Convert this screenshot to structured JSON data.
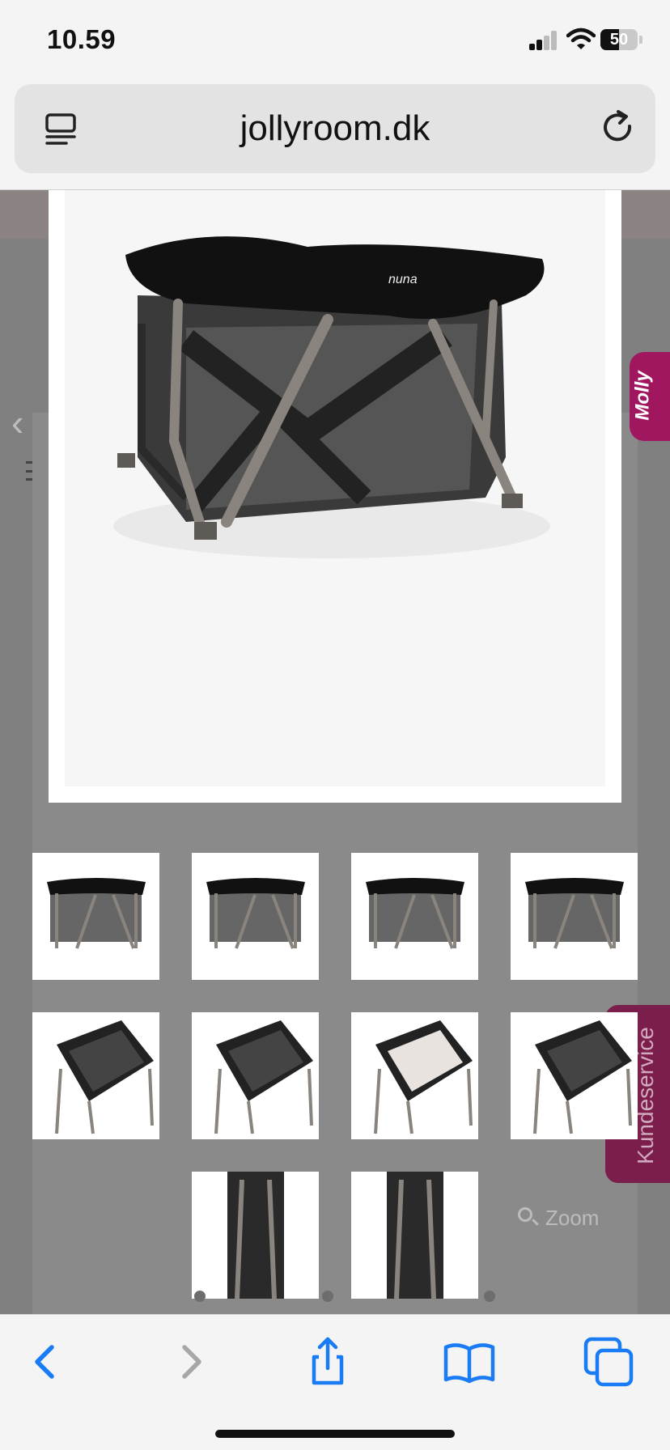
{
  "status_bar": {
    "time": "10.59",
    "battery": "50",
    "battery_level": 0.5
  },
  "browser": {
    "domain": "jollyroom.dk"
  },
  "page": {
    "molly_tab": "Molly",
    "customer_service_tab": "Kundeservice",
    "zoom_label": "Zoom"
  },
  "gallery": {
    "thumbnails": [
      {
        "view": "playpen-front-angle"
      },
      {
        "view": "playpen-side-angle"
      },
      {
        "view": "playpen-front"
      },
      {
        "view": "playpen-front-straight"
      },
      {
        "view": "playpen-top-bassinet"
      },
      {
        "view": "playpen-top-bassinet-2"
      },
      {
        "view": "playpen-top-mattress"
      },
      {
        "view": "playpen-canopy"
      },
      {
        "view": "playpen-folded-front"
      },
      {
        "view": "playpen-folded-back"
      }
    ]
  },
  "toolbar": {
    "icons": [
      "back-icon",
      "forward-icon",
      "share-icon",
      "bookmarks-icon",
      "tabs-icon"
    ],
    "accent": "#1a7cf5",
    "disabled": "#a7a7a7"
  }
}
